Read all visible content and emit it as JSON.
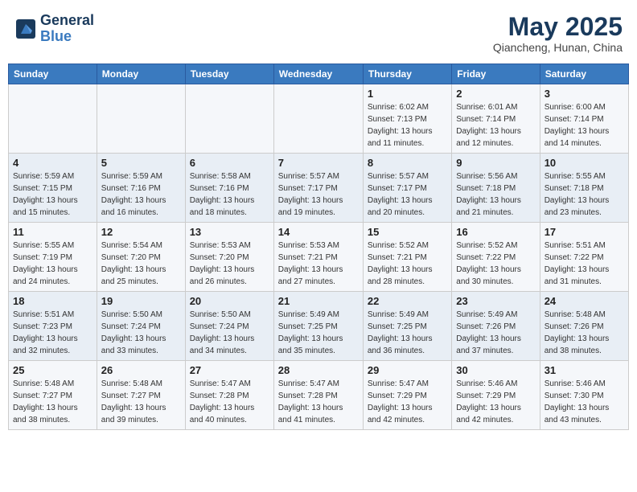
{
  "header": {
    "logo_line1": "General",
    "logo_line2": "Blue",
    "month_title": "May 2025",
    "location": "Qiancheng, Hunan, China"
  },
  "weekdays": [
    "Sunday",
    "Monday",
    "Tuesday",
    "Wednesday",
    "Thursday",
    "Friday",
    "Saturday"
  ],
  "weeks": [
    [
      {
        "day": "",
        "detail": ""
      },
      {
        "day": "",
        "detail": ""
      },
      {
        "day": "",
        "detail": ""
      },
      {
        "day": "",
        "detail": ""
      },
      {
        "day": "1",
        "detail": "Sunrise: 6:02 AM\nSunset: 7:13 PM\nDaylight: 13 hours\nand 11 minutes."
      },
      {
        "day": "2",
        "detail": "Sunrise: 6:01 AM\nSunset: 7:14 PM\nDaylight: 13 hours\nand 12 minutes."
      },
      {
        "day": "3",
        "detail": "Sunrise: 6:00 AM\nSunset: 7:14 PM\nDaylight: 13 hours\nand 14 minutes."
      }
    ],
    [
      {
        "day": "4",
        "detail": "Sunrise: 5:59 AM\nSunset: 7:15 PM\nDaylight: 13 hours\nand 15 minutes."
      },
      {
        "day": "5",
        "detail": "Sunrise: 5:59 AM\nSunset: 7:16 PM\nDaylight: 13 hours\nand 16 minutes."
      },
      {
        "day": "6",
        "detail": "Sunrise: 5:58 AM\nSunset: 7:16 PM\nDaylight: 13 hours\nand 18 minutes."
      },
      {
        "day": "7",
        "detail": "Sunrise: 5:57 AM\nSunset: 7:17 PM\nDaylight: 13 hours\nand 19 minutes."
      },
      {
        "day": "8",
        "detail": "Sunrise: 5:57 AM\nSunset: 7:17 PM\nDaylight: 13 hours\nand 20 minutes."
      },
      {
        "day": "9",
        "detail": "Sunrise: 5:56 AM\nSunset: 7:18 PM\nDaylight: 13 hours\nand 21 minutes."
      },
      {
        "day": "10",
        "detail": "Sunrise: 5:55 AM\nSunset: 7:18 PM\nDaylight: 13 hours\nand 23 minutes."
      }
    ],
    [
      {
        "day": "11",
        "detail": "Sunrise: 5:55 AM\nSunset: 7:19 PM\nDaylight: 13 hours\nand 24 minutes."
      },
      {
        "day": "12",
        "detail": "Sunrise: 5:54 AM\nSunset: 7:20 PM\nDaylight: 13 hours\nand 25 minutes."
      },
      {
        "day": "13",
        "detail": "Sunrise: 5:53 AM\nSunset: 7:20 PM\nDaylight: 13 hours\nand 26 minutes."
      },
      {
        "day": "14",
        "detail": "Sunrise: 5:53 AM\nSunset: 7:21 PM\nDaylight: 13 hours\nand 27 minutes."
      },
      {
        "day": "15",
        "detail": "Sunrise: 5:52 AM\nSunset: 7:21 PM\nDaylight: 13 hours\nand 28 minutes."
      },
      {
        "day": "16",
        "detail": "Sunrise: 5:52 AM\nSunset: 7:22 PM\nDaylight: 13 hours\nand 30 minutes."
      },
      {
        "day": "17",
        "detail": "Sunrise: 5:51 AM\nSunset: 7:22 PM\nDaylight: 13 hours\nand 31 minutes."
      }
    ],
    [
      {
        "day": "18",
        "detail": "Sunrise: 5:51 AM\nSunset: 7:23 PM\nDaylight: 13 hours\nand 32 minutes."
      },
      {
        "day": "19",
        "detail": "Sunrise: 5:50 AM\nSunset: 7:24 PM\nDaylight: 13 hours\nand 33 minutes."
      },
      {
        "day": "20",
        "detail": "Sunrise: 5:50 AM\nSunset: 7:24 PM\nDaylight: 13 hours\nand 34 minutes."
      },
      {
        "day": "21",
        "detail": "Sunrise: 5:49 AM\nSunset: 7:25 PM\nDaylight: 13 hours\nand 35 minutes."
      },
      {
        "day": "22",
        "detail": "Sunrise: 5:49 AM\nSunset: 7:25 PM\nDaylight: 13 hours\nand 36 minutes."
      },
      {
        "day": "23",
        "detail": "Sunrise: 5:49 AM\nSunset: 7:26 PM\nDaylight: 13 hours\nand 37 minutes."
      },
      {
        "day": "24",
        "detail": "Sunrise: 5:48 AM\nSunset: 7:26 PM\nDaylight: 13 hours\nand 38 minutes."
      }
    ],
    [
      {
        "day": "25",
        "detail": "Sunrise: 5:48 AM\nSunset: 7:27 PM\nDaylight: 13 hours\nand 38 minutes."
      },
      {
        "day": "26",
        "detail": "Sunrise: 5:48 AM\nSunset: 7:27 PM\nDaylight: 13 hours\nand 39 minutes."
      },
      {
        "day": "27",
        "detail": "Sunrise: 5:47 AM\nSunset: 7:28 PM\nDaylight: 13 hours\nand 40 minutes."
      },
      {
        "day": "28",
        "detail": "Sunrise: 5:47 AM\nSunset: 7:28 PM\nDaylight: 13 hours\nand 41 minutes."
      },
      {
        "day": "29",
        "detail": "Sunrise: 5:47 AM\nSunset: 7:29 PM\nDaylight: 13 hours\nand 42 minutes."
      },
      {
        "day": "30",
        "detail": "Sunrise: 5:46 AM\nSunset: 7:29 PM\nDaylight: 13 hours\nand 42 minutes."
      },
      {
        "day": "31",
        "detail": "Sunrise: 5:46 AM\nSunset: 7:30 PM\nDaylight: 13 hours\nand 43 minutes."
      }
    ]
  ]
}
